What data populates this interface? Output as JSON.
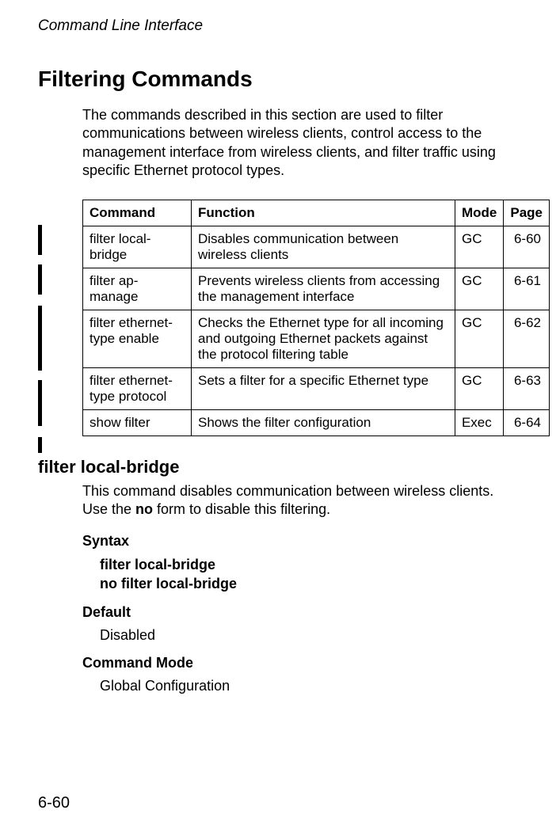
{
  "running_head": "Command Line Interface",
  "section_title": "Filtering Commands",
  "intro": "The commands described in this section are used to filter communications between wireless clients, control access to the management interface from wireless clients, and filter traffic using specific Ethernet protocol types.",
  "table": {
    "headers": [
      "Command",
      "Function",
      "Mode",
      "Page"
    ],
    "rows": [
      {
        "command": "filter local-bridge",
        "function": "Disables communication between wireless clients",
        "mode": "GC",
        "page": "6-60"
      },
      {
        "command": "filter ap-manage",
        "function": "Prevents wireless clients from accessing the management interface",
        "mode": "GC",
        "page": "6-61"
      },
      {
        "command": "filter ethernet-type enable",
        "function": "Checks the Ethernet type for all incoming and outgoing Ethernet packets against the protocol filtering table",
        "mode": "GC",
        "page": "6-62"
      },
      {
        "command": "filter ethernet-type protocol",
        "function": "Sets a filter for a specific Ethernet type",
        "mode": "GC",
        "page": "6-63"
      },
      {
        "command": "show filter",
        "function": "Shows the filter configuration",
        "mode": "Exec",
        "page": "6-64"
      }
    ]
  },
  "cmd1": {
    "heading": "filter local-bridge",
    "intro_pre": "This command disables communication between wireless clients. Use the ",
    "intro_bold": "no",
    "intro_post": " form to disable this filtering.",
    "syntax_label": "Syntax",
    "syntax_line1": "filter local-bridge",
    "syntax_line2": "no filter local-bridge",
    "default_label": "Default",
    "default_value": "Disabled",
    "mode_label": "Command Mode",
    "mode_value": "Global Configuration"
  },
  "page_number": "6-60"
}
